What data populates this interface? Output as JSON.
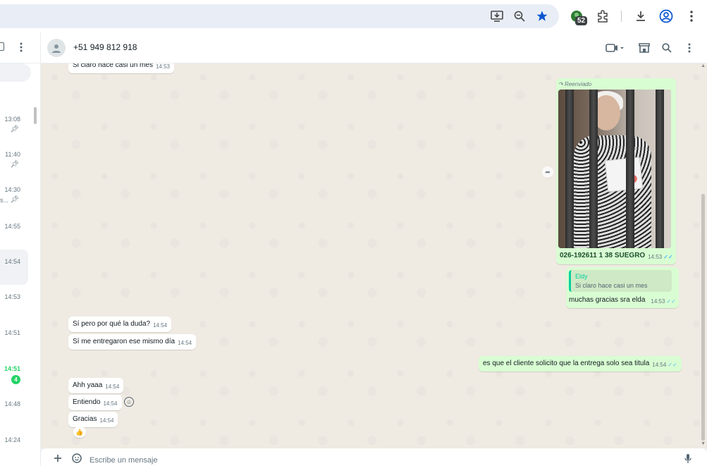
{
  "browser": {
    "extension_badge": "52"
  },
  "sidebar": {
    "chats": [
      {
        "time": "13:08",
        "pinned": true
      },
      {
        "time": "11:40",
        "pinned": true
      },
      {
        "time": "14:30",
        "pinned": true,
        "preview_fragment": "s..."
      },
      {
        "time": "14:55"
      },
      {
        "time": "14:54",
        "selected": true
      },
      {
        "time": "14:53"
      },
      {
        "time": "14:51"
      },
      {
        "time": "14:51",
        "unread_count": "4"
      },
      {
        "time": "14:48"
      },
      {
        "time": "14:24"
      }
    ]
  },
  "header": {
    "contact": "+51 949 812 918"
  },
  "messages": {
    "top_partial": {
      "text": "Si claro hace casi un mes",
      "time": "14:53"
    },
    "forwarded": {
      "label": "Reenviado",
      "caption": "026-192611 1 38 SUEGRO",
      "time": "14:53"
    },
    "reply": {
      "quote_author": "Eldy",
      "quote_text": "Si claro hace casi un mes",
      "text": "muchas gracias sra elda",
      "time": "14:53"
    },
    "in1": {
      "text": "Sí pero por qué la duda?",
      "time": "14:54"
    },
    "in2": {
      "text": "Sí me entregaron ese mismo día",
      "time": "14:54"
    },
    "out1": {
      "text": "es que el cliente solicito que la entrega solo sea titula",
      "time": "14:54"
    },
    "in3": {
      "text": "Ahh yaaa",
      "time": "14:54"
    },
    "in4": {
      "text": "Entiendo",
      "time": "14:54"
    },
    "in5": {
      "text": "Gracias",
      "time": "14:54"
    },
    "reaction": "👍"
  },
  "composer": {
    "placeholder": "Escribe un mensaje"
  },
  "colors": {
    "outgoing_bubble": "#d9fdd3",
    "incoming_bubble": "#ffffff",
    "accent": "#25d366",
    "read_ticks": "#53bdeb"
  }
}
